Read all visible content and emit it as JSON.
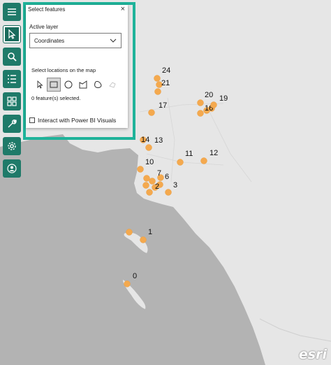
{
  "panel": {
    "title": "Select features",
    "close_glyph": "×",
    "active_layer_label": "Active layer",
    "active_layer_value": "Coordinates",
    "select_locations_label": "Select locations on the map",
    "shapes": [
      "pointer-icon",
      "rectangle-icon",
      "circle-icon",
      "lasso-icon",
      "polygon-icon",
      "reference-layer-icon"
    ],
    "selected_shape": "rectangle-icon",
    "feature_count_text": "0 feature(s) selected.",
    "interact_label": "Interact with Power BI Visuals",
    "interact_checked": false
  },
  "toolbar": {
    "items": [
      {
        "name": "menu-button",
        "icon": "hamburger-icon",
        "active": false
      },
      {
        "name": "select-button",
        "icon": "cursor-icon",
        "active": true
      },
      {
        "name": "search-button",
        "icon": "search-icon",
        "active": false
      },
      {
        "name": "layers-list-button",
        "icon": "list-icon",
        "active": false
      },
      {
        "name": "basemap-gallery-button",
        "icon": "grid-icon",
        "active": false
      },
      {
        "name": "analysis-tools-button",
        "icon": "wrench-icon",
        "active": false
      },
      {
        "name": "settings-button",
        "icon": "gear-icon",
        "active": false
      },
      {
        "name": "account-button",
        "icon": "user-icon",
        "active": false
      }
    ]
  },
  "map": {
    "points": [
      {
        "label": "0"
      },
      {
        "label": "1"
      },
      {
        "label": "2"
      },
      {
        "label": "3"
      },
      {
        "label": "6"
      },
      {
        "label": "7"
      },
      {
        "label": "10"
      },
      {
        "label": "11"
      },
      {
        "label": "12"
      },
      {
        "label": "13"
      },
      {
        "label": "14"
      },
      {
        "label": "16"
      },
      {
        "label": "17"
      },
      {
        "label": "19"
      },
      {
        "label": "20"
      },
      {
        "label": "21"
      },
      {
        "label": "24"
      }
    ],
    "point_color": "#f4a94e",
    "land_color": "#e6e6e6",
    "water_color": "#b3b3b3"
  },
  "attribution": {
    "logo_text": "esri"
  },
  "colors": {
    "toolbar": "#1f7a69",
    "highlight": "#1fb39a"
  }
}
